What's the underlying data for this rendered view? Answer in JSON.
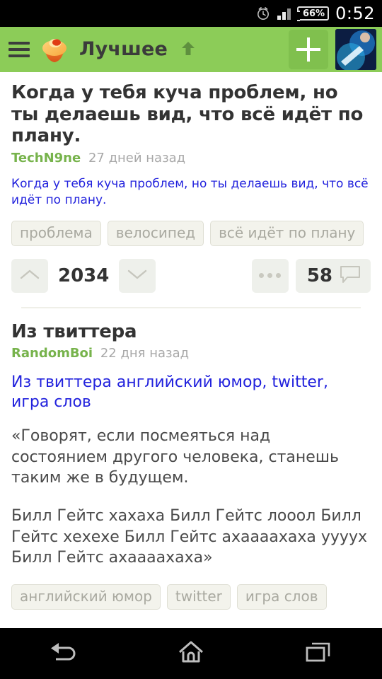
{
  "status_bar": {
    "alarm_icon": "alarm-clock-icon",
    "signal_icon": "cellular-signal-icon",
    "battery_percent": "66%",
    "time": "0:52"
  },
  "app_bar": {
    "menu_icon": "hamburger-menu-icon",
    "logo_icon": "cupcake-logo-icon",
    "title": "Лучшее",
    "title_arrow_icon": "arrow-up-icon",
    "add_icon": "plus-icon",
    "avatar_icon": "user-avatar"
  },
  "posts": [
    {
      "title": "Когда у тебя куча проблем, но ты делаешь вид, что всё идёт по плану.",
      "author": "TechN9ne",
      "time": "27 дней назад",
      "link_text": "Когда у тебя куча проблем, но ты делаешь вид, что всё идёт по плану.",
      "tags": [
        "проблема",
        "велосипед",
        "всё идёт по плану"
      ],
      "score": "2034",
      "comments": "58",
      "upvote_icon": "chevron-up-icon",
      "downvote_icon": "chevron-down-icon",
      "more_icon": "more-options-icon",
      "comment_icon": "speech-bubble-icon"
    },
    {
      "title": "Из твиттера",
      "author": "RandomBoi",
      "time": "22 дня назад",
      "link_text": "Из твиттера английский юмор, twitter, игра слов",
      "body": [
        "«Говорят, если посмеяться над состоянием другого человека, станешь таким же в будущем.",
        "Билл Гейтс хахаха Билл Гейтс лооол Билл Гейтс хехехе Билл Гейтс ахаааахаха уууух Билл Гейтс ахаааахаха»"
      ],
      "tags": [
        "английский юмор",
        "twitter",
        "игра слов"
      ]
    }
  ],
  "nav_bar": {
    "back_icon": "back-arrow-icon",
    "home_icon": "home-icon",
    "recents_icon": "recent-apps-icon"
  },
  "colors": {
    "accent_green": "#8ccc58",
    "author_green": "#77b34c",
    "link_blue": "#2222dd",
    "tag_bg": "#f3f3ec"
  }
}
